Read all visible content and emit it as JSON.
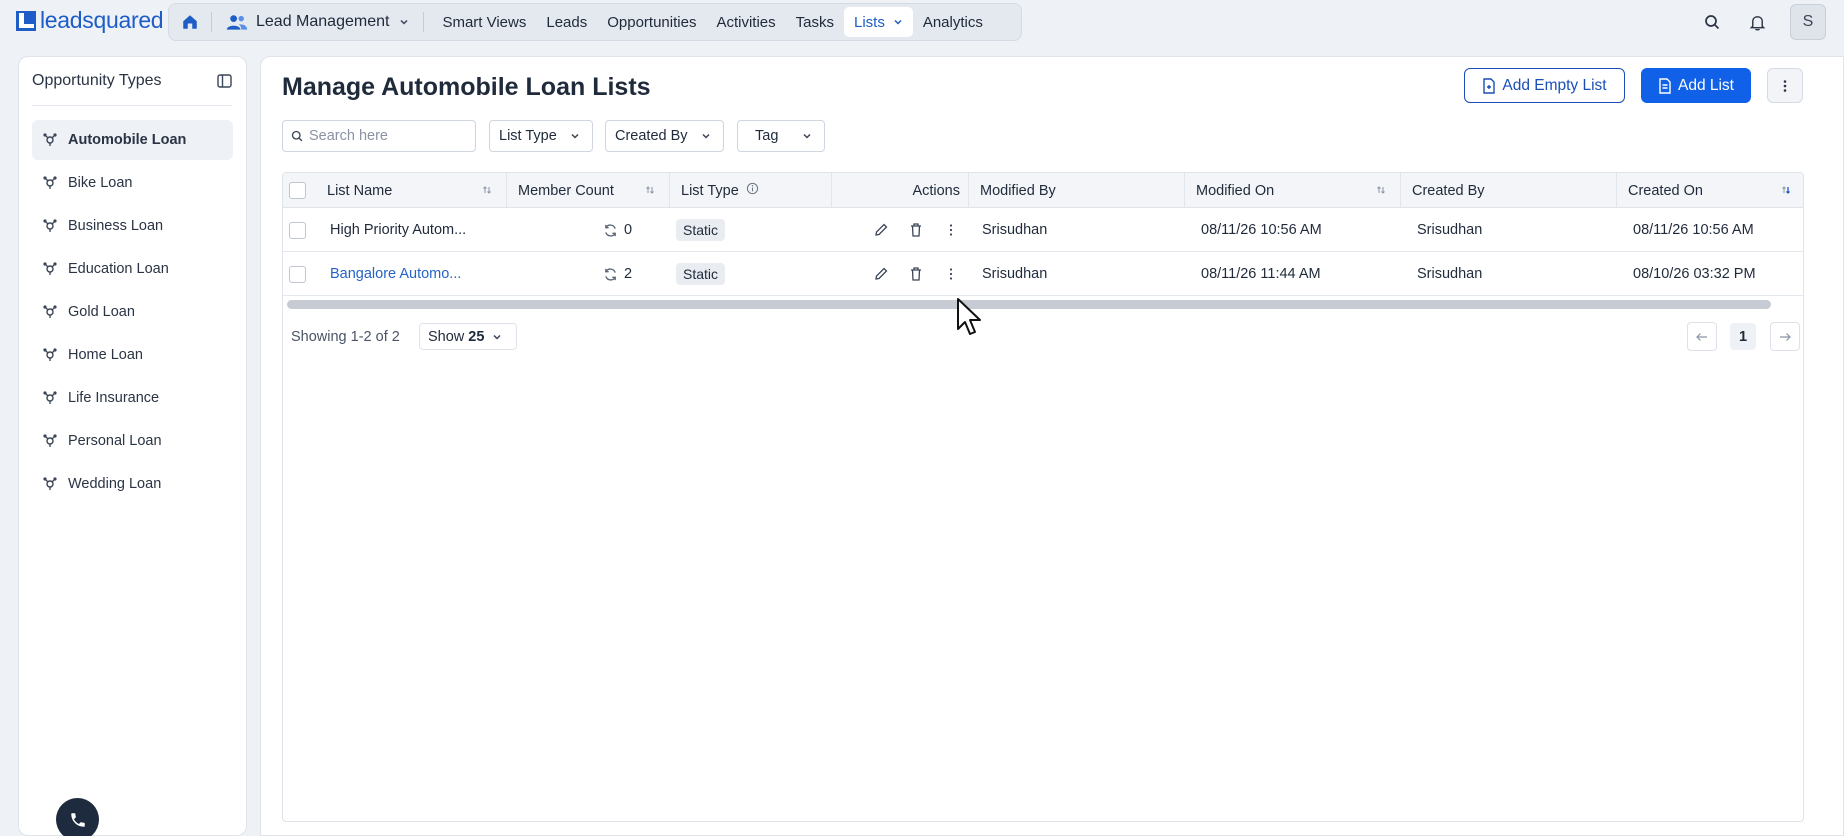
{
  "brand": {
    "name": "leadsquared"
  },
  "nav": {
    "app_label": "Lead Management",
    "items": [
      {
        "label": "Smart Views"
      },
      {
        "label": "Leads"
      },
      {
        "label": "Opportunities"
      },
      {
        "label": "Activities"
      },
      {
        "label": "Tasks"
      },
      {
        "label": "Lists",
        "active": true
      },
      {
        "label": "Analytics"
      }
    ]
  },
  "user": {
    "initial": "S"
  },
  "sidebar": {
    "title": "Opportunity Types",
    "items": [
      {
        "label": "Automobile Loan",
        "active": true
      },
      {
        "label": "Bike Loan"
      },
      {
        "label": "Business Loan"
      },
      {
        "label": "Education Loan"
      },
      {
        "label": "Gold Loan"
      },
      {
        "label": "Home Loan"
      },
      {
        "label": "Life Insurance"
      },
      {
        "label": "Personal Loan"
      },
      {
        "label": "Wedding Loan"
      }
    ]
  },
  "page": {
    "title": "Manage Automobile Loan Lists",
    "add_empty_list": "Add Empty List",
    "add_list": "Add List"
  },
  "filters": {
    "search_placeholder": "Search here",
    "list_type": "List Type",
    "created_by": "Created By",
    "tag": "Tag"
  },
  "table": {
    "columns": {
      "list_name": "List Name",
      "member_count": "Member Count",
      "list_type": "List Type",
      "actions": "Actions",
      "modified_by": "Modified By",
      "modified_on": "Modified On",
      "created_by": "Created By",
      "created_on": "Created On"
    },
    "rows": [
      {
        "list_name": "High Priority Autom...",
        "member_count": "0",
        "list_type": "Static",
        "modified_by": "Srisudhan",
        "modified_on": "08/11/26 10:56 AM",
        "created_by": "Srisudhan",
        "created_on": "08/11/26 10:56 AM"
      },
      {
        "list_name": "Bangalore Automo...",
        "member_count": "2",
        "list_type": "Static",
        "modified_by": "Srisudhan",
        "modified_on": "08/11/26 11:44 AM",
        "created_by": "Srisudhan",
        "created_on": "08/10/26 03:32 PM"
      }
    ]
  },
  "pagination": {
    "showing": "Showing 1-2 of 2",
    "show_label": "Show",
    "show_value": "25",
    "current_page": "1"
  },
  "colors": {
    "primary": "#1160e8",
    "link": "#2563c9",
    "brand": "#1e5dc7"
  }
}
